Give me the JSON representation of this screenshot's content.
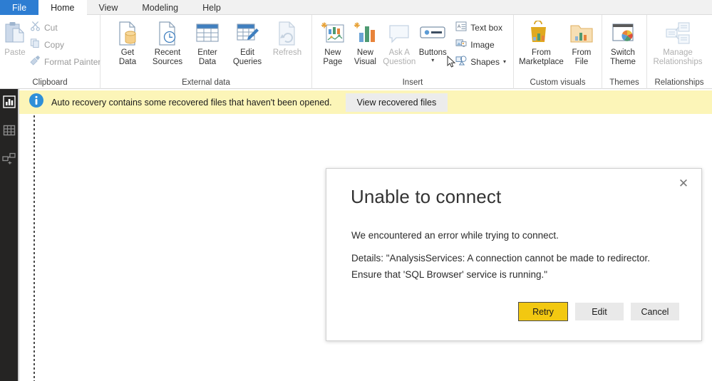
{
  "app": {
    "name": "Power BI Desktop"
  },
  "tabs": [
    {
      "label": "File",
      "state": "file"
    },
    {
      "label": "Home",
      "state": "active"
    },
    {
      "label": "View",
      "state": "normal"
    },
    {
      "label": "Modeling",
      "state": "normal"
    },
    {
      "label": "Help",
      "state": "normal"
    }
  ],
  "ribbon": {
    "groups": [
      {
        "label": "Clipboard",
        "big": [
          {
            "label": "Paste",
            "icon": "paste-icon",
            "disabled": true
          }
        ],
        "small": [
          {
            "label": "Cut",
            "icon": "scissors-icon",
            "disabled": true
          },
          {
            "label": "Copy",
            "icon": "copy-icon",
            "disabled": true
          },
          {
            "label": "Format Painter",
            "icon": "format-painter-icon",
            "disabled": true
          }
        ]
      },
      {
        "label": "External data",
        "big": [
          {
            "label": "Get\nData",
            "icon": "get-data-icon",
            "caret": true
          },
          {
            "label": "Recent\nSources",
            "icon": "recent-sources-icon",
            "caret": true
          },
          {
            "label": "Enter\nData",
            "icon": "enter-data-icon",
            "caret": false
          },
          {
            "label": "Edit\nQueries",
            "icon": "edit-queries-icon",
            "caret": true
          },
          {
            "label": "Refresh",
            "icon": "refresh-icon",
            "caret": false,
            "disabled": true
          }
        ]
      },
      {
        "label": "Insert",
        "big": [
          {
            "label": "New\nPage",
            "icon": "new-page-icon",
            "caret": true
          },
          {
            "label": "New\nVisual",
            "icon": "new-visual-icon",
            "caret": false
          },
          {
            "label": "Ask A\nQuestion",
            "icon": "ask-question-icon",
            "caret": false,
            "disabled": true
          },
          {
            "label": "Buttons",
            "icon": "buttons-icon",
            "caret": true
          }
        ],
        "small": [
          {
            "label": "Text box",
            "icon": "text-box-icon"
          },
          {
            "label": "Image",
            "icon": "image-icon"
          },
          {
            "label": "Shapes",
            "icon": "shapes-icon",
            "caret": true
          }
        ]
      },
      {
        "label": "Custom visuals",
        "big": [
          {
            "label": "From\nMarketplace",
            "icon": "marketplace-icon",
            "caret": false
          },
          {
            "label": "From\nFile",
            "icon": "from-file-icon",
            "caret": false
          }
        ]
      },
      {
        "label": "Themes",
        "big": [
          {
            "label": "Switch\nTheme",
            "icon": "switch-theme-icon",
            "caret": true
          }
        ]
      },
      {
        "label": "Relationships",
        "big": [
          {
            "label": "Manage\nRelationships",
            "icon": "manage-relationships-icon",
            "caret": false,
            "disabled": true
          }
        ]
      }
    ]
  },
  "rail": {
    "items": [
      {
        "name": "report-view",
        "icon": "bar-chart-icon",
        "selected": true
      },
      {
        "name": "data-view",
        "icon": "table-icon",
        "selected": false
      },
      {
        "name": "model-view",
        "icon": "relationships-icon",
        "selected": false
      }
    ]
  },
  "notification": {
    "icon": "info-icon",
    "message": "Auto recovery contains some recovered files that haven't been opened.",
    "action_label": "View recovered files",
    "background": "#fcf5b8"
  },
  "dialog": {
    "title": "Unable to connect",
    "paragraph1": "We encountered an error while trying to connect.",
    "paragraph2": "Details: \"AnalysisServices: A connection cannot be made to redirector. Ensure that 'SQL Browser' service is running.\"",
    "close_icon": "close-icon",
    "close_glyph": "✕",
    "buttons": [
      {
        "label": "Retry",
        "style": "primary"
      },
      {
        "label": "Edit",
        "style": "secondary"
      },
      {
        "label": "Cancel",
        "style": "secondary"
      }
    ]
  },
  "colors": {
    "file_tab": "#2d7dd2",
    "accent_yellow": "#f2c811",
    "notice_bg": "#fcf5b8",
    "rail_bg": "#252423",
    "info_blue": "#2e8fd8"
  }
}
